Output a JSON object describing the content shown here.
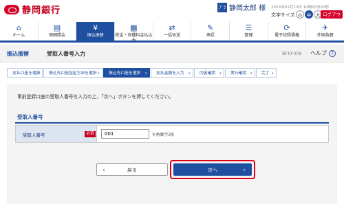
{
  "header": {
    "bank_name": "静岡銀行",
    "user_icon_text": "ﾌﾞﾗ",
    "user_name": "静岡太郎 様",
    "last_login": "20XX年02月13日 10時00分00秒",
    "font_size_label": "文字サイズ",
    "font_small": "小",
    "font_medium": "中",
    "font_large": "大",
    "logout": "ログアウト"
  },
  "nav": {
    "items": [
      {
        "label": "ホーム",
        "icon": "home-icon",
        "glyph": "⌂"
      },
      {
        "label": "明細照会",
        "icon": "document-icon",
        "glyph": "▤"
      },
      {
        "label": "振込振替",
        "icon": "yen-icon",
        "glyph": "¥"
      },
      {
        "label": "税金・各種料金払込み",
        "icon": "tax-icon",
        "glyph": "▦"
      },
      {
        "label": "一括伝送",
        "icon": "transfer-icon",
        "glyph": "⇄"
      },
      {
        "label": "承認",
        "icon": "approval-icon",
        "glyph": "✎"
      },
      {
        "label": "管理",
        "icon": "manage-icon",
        "glyph": "☰"
      },
      {
        "label": "電子記録債権",
        "icon": "ereceivable-icon",
        "glyph": "⟳"
      },
      {
        "label": "外国為替",
        "icon": "forex-icon",
        "glyph": "✈"
      }
    ],
    "active_index": 2
  },
  "title_bar": {
    "main": "振込振替",
    "sub": "受取人番号入力",
    "screen_id": "BFKF008",
    "help": "ヘルプ",
    "help_icon": "?"
  },
  "steps": [
    {
      "label": "支払口座を選択",
      "width": 52
    },
    {
      "label": "振込先口座指定方法を選択",
      "width": 86
    },
    {
      "label": "振込先口座を選択",
      "width": 68
    },
    {
      "label": "支払金額を入力",
      "width": 62
    },
    {
      "label": "内容確認",
      "width": 44
    },
    {
      "label": "実行確認",
      "width": 44
    },
    {
      "label": "完了",
      "width": 30
    }
  ],
  "steps_active": 2,
  "main": {
    "instruction": "事前登録口座の受取人番号を入力の上、「次へ」ボタンを押してください。",
    "section_title": "受取人番号",
    "field_label": "受取人番号",
    "required": "必須",
    "field_value": "001",
    "field_hint": "半角数字3桁",
    "back_label": "戻る",
    "next_label": "次へ"
  }
}
